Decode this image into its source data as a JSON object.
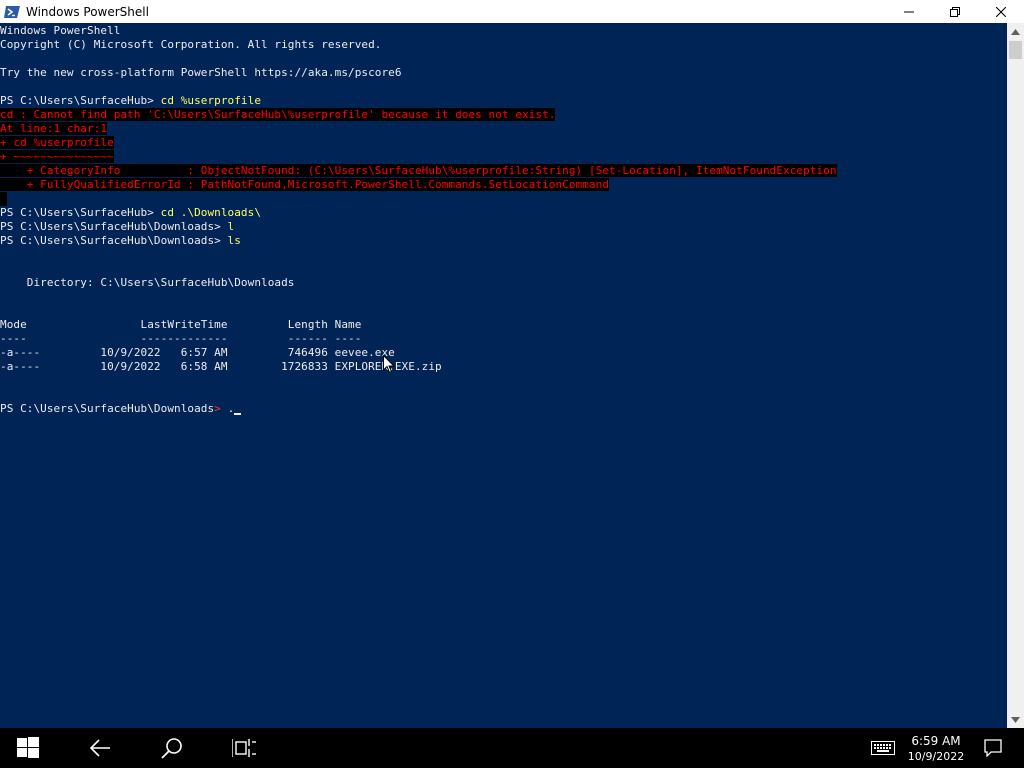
{
  "window": {
    "title": "Windows PowerShell",
    "icon": "powershell-icon"
  },
  "console": {
    "banner_line1": "Windows PowerShell",
    "banner_line2": "Copyright (C) Microsoft Corporation. All rights reserved.",
    "banner_line3": "Try the new cross-platform PowerShell https://aka.ms/pscore6",
    "prompt1": "PS C:\\Users\\SurfaceHub> ",
    "cmd1": "cd %userprofile",
    "error_line1": "cd : Cannot find path 'C:\\Users\\SurfaceHub\\%userprofile' because it does not exist.",
    "error_line2": "At line:1 char:1",
    "error_line3": "+ cd %userprofile",
    "error_line4": "+ ~~~~~~~~~~~~~~~",
    "error_line5": "    + CategoryInfo          : ObjectNotFound: (C:\\Users\\SurfaceHub\\%userprofile:String) [Set-Location], ItemNotFoundException",
    "error_line6": "    + FullyQualifiedErrorId : PathNotFound,Microsoft.PowerShell.Commands.SetLocationCommand",
    "prompt2": "PS C:\\Users\\SurfaceHub> ",
    "cmd2": "cd .\\Downloads\\",
    "prompt3": "PS C:\\Users\\SurfaceHub\\Downloads> ",
    "cmd3": "l",
    "prompt4": "PS C:\\Users\\SurfaceHub\\Downloads> ",
    "cmd4": "ls",
    "directory_line": "    Directory: C:\\Users\\SurfaceHub\\Downloads",
    "table_header": "Mode                 LastWriteTime         Length Name",
    "table_divider": "----                 -------------         ------ ----",
    "rows": [
      {
        "mode": "-a----",
        "date": "10/9/2022",
        "time": "6:57 AM",
        "length": "746496",
        "name": "eevee.exe"
      },
      {
        "mode": "-a----",
        "date": "10/9/2022",
        "time": "6:58 AM",
        "length": "1726833",
        "name": "EXPLORER.EXE.zip"
      }
    ],
    "row1_text": "-a----         10/9/2022   6:57 AM         746496 eevee.exe",
    "row2_text": "-a----         10/9/2022   6:58 AM        1726833 EXPLORER.EXE.zip",
    "prompt5": "PS C:\\Users\\SurfaceHub\\Downloads",
    "prompt5_arrow": ">",
    "prompt5_input": " ."
  },
  "taskbar": {
    "clock_time": "6:59 AM",
    "clock_date": "10/9/2022",
    "icons": [
      "windows-start-icon",
      "back-arrow-icon",
      "search-icon",
      "task-view-icon",
      "keyboard-icon",
      "action-center-icon"
    ]
  },
  "colors": {
    "console_bg": "#012456",
    "console_text": "#eeedf0",
    "command_text": "#ffff66",
    "error_text": "#ff0000",
    "error_bg": "#000000"
  }
}
